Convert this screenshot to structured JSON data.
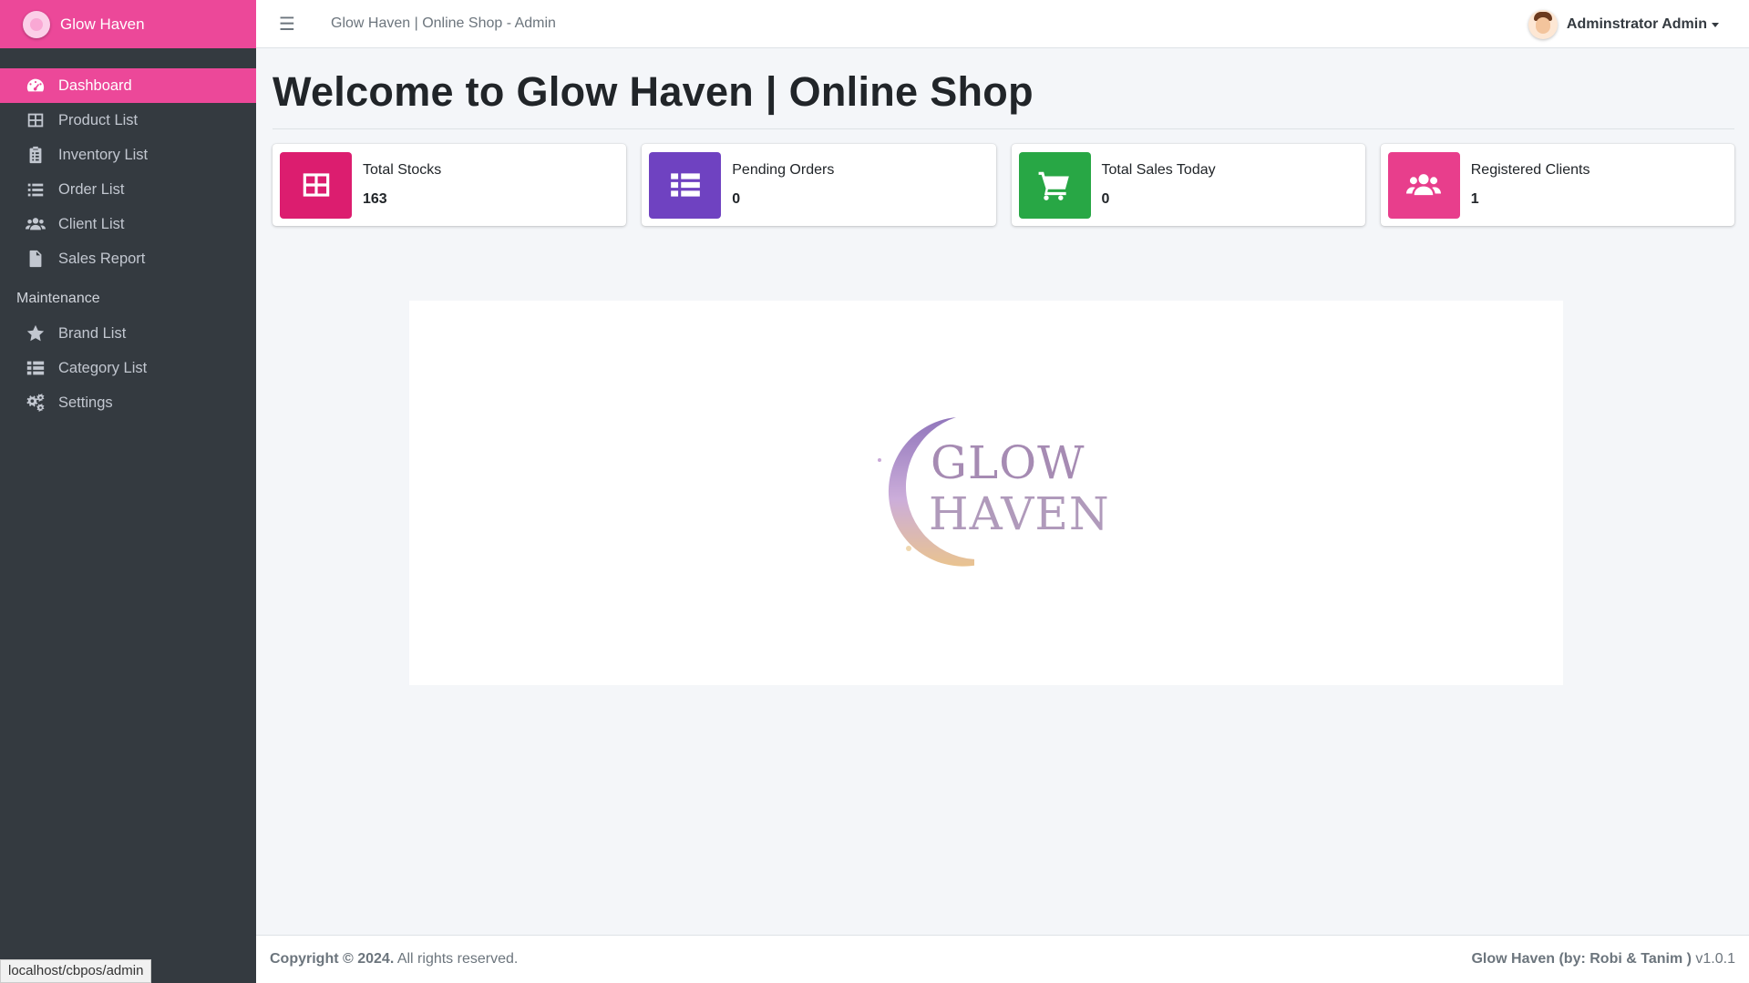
{
  "brand": {
    "name": "Glow Haven"
  },
  "sidebar": {
    "items": [
      {
        "label": "Dashboard",
        "icon": "dashboard-icon",
        "active": true
      },
      {
        "label": "Product List",
        "icon": "table-icon"
      },
      {
        "label": "Inventory List",
        "icon": "clipboard-icon"
      },
      {
        "label": "Order List",
        "icon": "list-icon"
      },
      {
        "label": "Client List",
        "icon": "users-icon"
      },
      {
        "label": "Sales Report",
        "icon": "file-icon"
      }
    ],
    "maintenance_header": "Maintenance",
    "maintenance_items": [
      {
        "label": "Brand List",
        "icon": "star-icon"
      },
      {
        "label": "Category List",
        "icon": "th-list-icon"
      },
      {
        "label": "Settings",
        "icon": "cogs-icon"
      }
    ]
  },
  "topbar": {
    "title": "Glow Haven | Online Shop - Admin",
    "user_name": "Adminstrator Admin"
  },
  "main": {
    "title": "Welcome to Glow Haven | Online Shop",
    "cards": [
      {
        "label": "Total Stocks",
        "value": "163",
        "color": "#dc1d6f",
        "icon": "table-icon"
      },
      {
        "label": "Pending Orders",
        "value": "0",
        "color": "#6f42c1",
        "icon": "list-icon"
      },
      {
        "label": "Total Sales Today",
        "value": "0",
        "color": "#28a745",
        "icon": "cart-icon"
      },
      {
        "label": "Registered Clients",
        "value": "1",
        "color": "#e83e8c",
        "icon": "users-icon"
      }
    ],
    "banner_logo": {
      "line1": "GLOW",
      "line2": "HAVEN"
    }
  },
  "footer": {
    "copyright_bold": "Copyright © 2024.",
    "copyright_rest": "All rights reserved.",
    "credit_bold": "Glow Haven (by: Robi & Tanim )",
    "version": "v1.0.1"
  },
  "statusbar": {
    "url": "localhost/cbpos/admin"
  }
}
